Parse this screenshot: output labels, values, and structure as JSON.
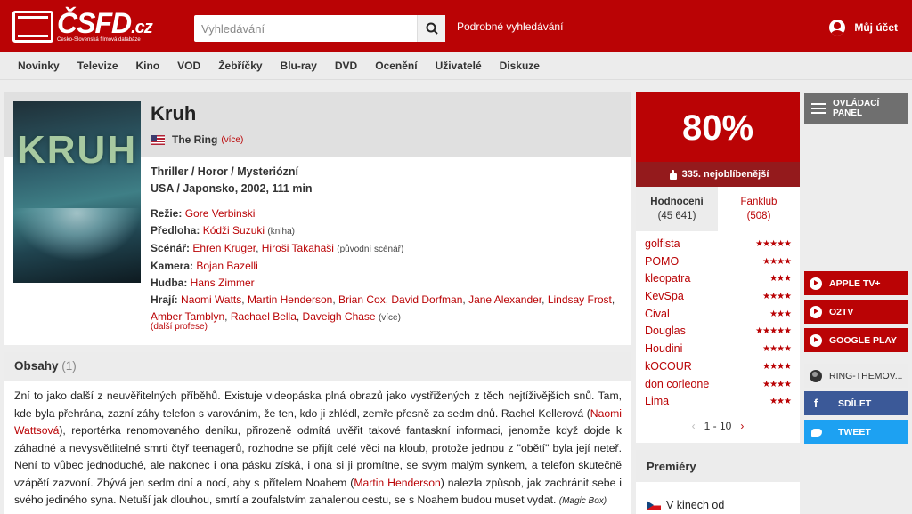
{
  "header": {
    "logo_text": "ČSFD",
    "logo_tld": ".cz",
    "logo_subtitle": "Česko-Slovenská filmová databáze",
    "search_placeholder": "Vyhledávání",
    "advanced_search": "Podrobné vyhledávání",
    "account": "Můj účet"
  },
  "nav": [
    "Novinky",
    "Televize",
    "Kino",
    "VOD",
    "Žebříčky",
    "Blu-ray",
    "DVD",
    "Ocenění",
    "Uživatelé",
    "Diskuze"
  ],
  "film": {
    "title": "Kruh",
    "poster_title": "KRUH",
    "alt_title": "The Ring",
    "alt_more": "(více)",
    "genres": "Thriller / Horor / Mysteriózní",
    "origin": "USA / Japonsko, 2002, 111 min",
    "creators": [
      {
        "role": "Režie:",
        "names": [
          "Gore Verbinski"
        ],
        "note": ""
      },
      {
        "role": "Předloha:",
        "names": [
          "Kódži Suzuki"
        ],
        "note": "(kniha)"
      },
      {
        "role": "Scénář:",
        "names": [
          "Ehren Kruger",
          "Hiroši Takahaši"
        ],
        "note": "(původní scénář)"
      },
      {
        "role": "Kamera:",
        "names": [
          "Bojan Bazelli"
        ],
        "note": ""
      },
      {
        "role": "Hudba:",
        "names": [
          "Hans Zimmer"
        ],
        "note": ""
      },
      {
        "role": "Hrají:",
        "names": [
          "Naomi Watts",
          "Martin Henderson",
          "Brian Cox",
          "David Dorfman",
          "Jane Alexander",
          "Lindsay Frost",
          "Amber Tamblyn",
          "Rachael Bella",
          "Daveigh Chase"
        ],
        "note": "(více)"
      }
    ],
    "other_professions": "(další profese)"
  },
  "plot": {
    "heading": "Obsahy",
    "count": "(1)",
    "text_1": "Zní to jako další z neuvěřitelných příběhů. Existuje videopáska plná obrazů jako vystřižených z těch nejtíživějších snů. Tam, kde byla přehrána, zazní záhy telefon s varováním, že ten, kdo ji zhlédl, zemře přesně za sedm dnů. Rachel Kellerová (",
    "link_1": "Naomi Wattsová",
    "text_2": "), reportérka renomovaného deníku, přirozeně odmítá uvěřit takové fantaskní informaci, jenomže když dojde k záhadné a nevysvětlitelné smrti čtyř teenagerů, rozhodne se přijít celé věci na kloub, protože jednou z \"obětí\" byla její neteř. Není to vůbec jednoduché, ale nakonec i ona pásku získá, i ona si ji promítne, se svým malým synkem, a telefon skutečně vzápětí zazvoní. Zbývá jen sedm dní a nocí, aby s přítelem Noahem (",
    "link_2": "Martin Henderson",
    "text_3": ") nalezla způsob, jak zachránit sebe i svého jediného syna. Netuší jak dlouhou, smrtí a zoufalstvím zahalenou cestu, se s Noahem budou muset vydat. ",
    "source": "(Magic Box)"
  },
  "rating": {
    "percent": "80%",
    "favorite": "335. nejoblíbenější",
    "tab_ratings_label": "Hodnocení",
    "tab_ratings_count": "(45 641)",
    "tab_fanclub_label": "Fanklub",
    "tab_fanclub_count": "(508)",
    "users": [
      {
        "name": "golfista",
        "stars": "★★★★★"
      },
      {
        "name": "POMO",
        "stars": "★★★★"
      },
      {
        "name": "kleopatra",
        "stars": "★★★"
      },
      {
        "name": "KevSpa",
        "stars": "★★★★"
      },
      {
        "name": "Cival",
        "stars": "★★★"
      },
      {
        "name": "Douglas",
        "stars": "★★★★★"
      },
      {
        "name": "Houdini",
        "stars": "★★★★"
      },
      {
        "name": "kOCOUR",
        "stars": "★★★★"
      },
      {
        "name": "don corleone",
        "stars": "★★★★"
      },
      {
        "name": "Lima",
        "stars": "★★★"
      }
    ],
    "pager_prev": "‹",
    "pager_range": "1 - 10",
    "pager_next": "›"
  },
  "premiery": {
    "heading": "Premiéry",
    "row": "V kinech od"
  },
  "side": {
    "panel": "OVLÁDACÍ PANEL",
    "vod": [
      "APPLE TV+",
      "O2TV",
      "GOOGLE PLAY"
    ],
    "website": "RING-THEMOV...",
    "share_fb": "SDÍLET",
    "share_tw": "TWEET"
  },
  "colors": {
    "brand": "#ba0305",
    "facebook": "#3b5998",
    "twitter": "#1da1f2"
  }
}
